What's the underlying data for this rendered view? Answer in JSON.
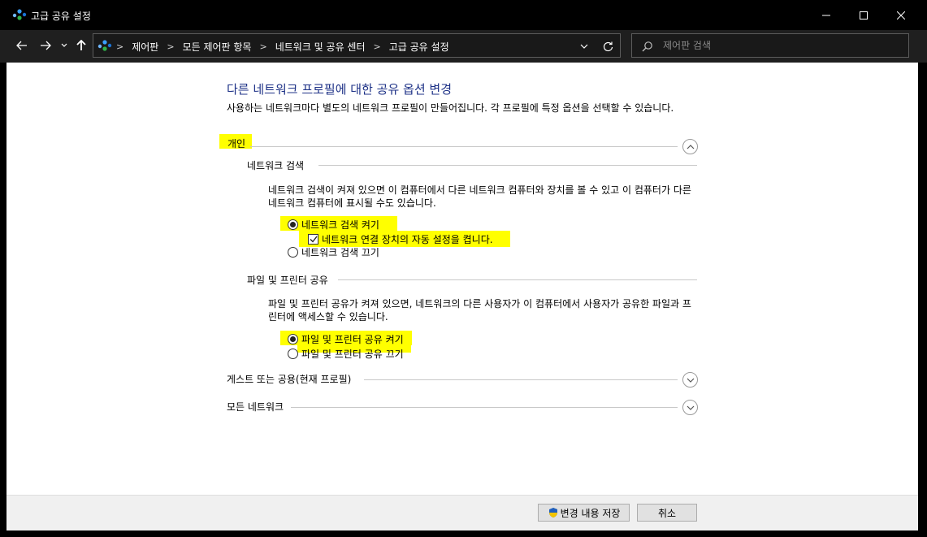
{
  "window": {
    "title": "고급 공유 설정"
  },
  "address_bar": {
    "crumbs": [
      "제어판",
      "모든 제어판 항목",
      "네트워크 및 공유 센터",
      "고급 공유 설정"
    ]
  },
  "search": {
    "placeholder": "제어판 검색"
  },
  "main": {
    "heading": "다른 네트워크 프로필에 대한 공유 옵션 변경",
    "description": "사용하는 네트워크마다 별도의 네트워크 프로필이 만들어집니다. 각 프로필에 특정 옵션을 선택할 수 있습니다.",
    "profiles": [
      {
        "label": "개인",
        "expanded": true,
        "sections": [
          {
            "label": "네트워크 검색",
            "description": "네트워크 검색이 켜져 있으면 이 컴퓨터에서 다른 네트워크 컴퓨터와 장치를 볼 수 있고 이 컴퓨터가 다른 네트워크 컴퓨터에 표시될 수도 있습니다.",
            "on_option": "네트워크 검색 켜기",
            "checkbox": "네트워크 연결 장치의 자동 설정을 켭니다.",
            "off_option": "네트워크 검색 끄기"
          },
          {
            "label": "파일 및 프린터 공유",
            "description": "파일 및 프린터 공유가 켜져 있으면, 네트워크의 다른 사용자가 이 컴퓨터에서 사용자가 공유한 파일과 프린터에 액세스할 수 있습니다.",
            "on_option": "파일 및 프린터 공유 켜기",
            "off_option": "파일 및 프린터 공유 끄기"
          }
        ]
      },
      {
        "label": "게스트 또는 공용(현재 프로필)",
        "expanded": false
      },
      {
        "label": "모든 네트워크",
        "expanded": false
      }
    ]
  },
  "footer": {
    "save_label": "변경 내용 저장",
    "cancel_label": "취소"
  },
  "colors": {
    "heading": "#1e3287",
    "highlight": "#ffff00",
    "window_bg": "#000000",
    "content_bg": "#ffffff"
  }
}
